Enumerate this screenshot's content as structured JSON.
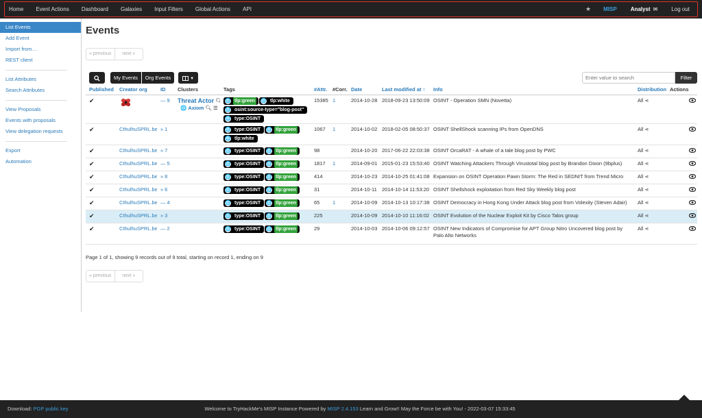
{
  "nav": {
    "items": [
      "Home",
      "Event Actions",
      "Dashboard",
      "Galaxies",
      "Input Filters",
      "Global Actions",
      "API"
    ],
    "star_icon": "star-icon",
    "instance": "MISP",
    "user": "Analyst",
    "mail_icon": "envelope-icon",
    "logout": "Log out"
  },
  "sidebar": {
    "group1": [
      "List Events",
      "Add Event",
      "Import from…",
      "REST client"
    ],
    "group2": [
      "List Attributes",
      "Search Attributes"
    ],
    "group3": [
      "View Proposals",
      "Events with proposals",
      "View delegation requests"
    ],
    "group4": [
      "Export",
      "Automation"
    ]
  },
  "main": {
    "title": "Events",
    "pager": {
      "prev": "« previous",
      "next": "next »"
    },
    "toolbar": {
      "my_events": "My Events",
      "org_events": "Org Events",
      "search_placeholder": "Enter value to search",
      "filter": "Filter"
    },
    "columns": [
      "Published",
      "Creator org",
      "ID",
      "Clusters",
      "Tags",
      "#Attr.",
      "#Corr.",
      "Date",
      "Last modified at ↑",
      "Info",
      "Distribution",
      "Actions"
    ],
    "rows": [
      {
        "published": "✔",
        "org": "",
        "org_logo": true,
        "id_prefix": "—",
        "id": "9",
        "cluster": "Threat Actor",
        "cluster_sub": "Axiom",
        "tags": [
          "tlp:green",
          "tlp:white",
          "osint:source-type=\"blog-post\"",
          "type:OSINT"
        ],
        "attr": "15385",
        "corr": "1",
        "date": "2014-10-28",
        "modified": "2018-09-23 13:50:09",
        "info": "OSINT - Operation SMN (Novetta)",
        "dist": "All"
      },
      {
        "published": "✔",
        "org": "CthulhuSPRL.be",
        "id_prefix": "»",
        "id": "1",
        "tags": [
          "type:OSINT",
          "tlp:green",
          "tlp:white"
        ],
        "attr": "1067",
        "corr": "1",
        "date": "2014-10-02",
        "modified": "2018-02-05 08:50:37",
        "info": "OSINT ShellShock scanning IPs from OpenDNS",
        "dist": "All"
      },
      {
        "published": "✔",
        "org": "CthulhuSPRL.be",
        "id_prefix": "»",
        "id": "7",
        "tags": [
          "type:OSINT",
          "tlp:green"
        ],
        "attr": "98",
        "corr": "",
        "date": "2014-10-20",
        "modified": "2017-06-22 22:03:38",
        "info": "OSINT OrcaRAT - A whale of a tale blog post by PWC",
        "dist": "All"
      },
      {
        "published": "✔",
        "org": "CthulhuSPRL.be",
        "id_prefix": "—",
        "id": "5",
        "tags": [
          "type:OSINT",
          "tlp:green"
        ],
        "attr": "1817",
        "corr": "1",
        "date": "2014-09-01",
        "modified": "2015-01-23 15:53:40",
        "info": "OSINT Watching Attackers Through Virustotal blog post by Brandon Dixon (9bplus)",
        "dist": "All"
      },
      {
        "published": "✔",
        "org": "CthulhuSPRL.be",
        "id_prefix": "»",
        "id": "8",
        "tags": [
          "type:OSINT",
          "tlp:green"
        ],
        "attr": "414",
        "corr": "",
        "date": "2014-10-23",
        "modified": "2014-10-25 01:41:08",
        "info": "Expansion on OSINT Operation Pawn Storm: The Red in SEDNIT from Trend Micro",
        "dist": "All"
      },
      {
        "published": "✔",
        "org": "CthulhuSPRL.be",
        "id_prefix": "»",
        "id": "6",
        "tags": [
          "type:OSINT",
          "tlp:green"
        ],
        "attr": "31",
        "corr": "",
        "date": "2014-10-11",
        "modified": "2014-10-14 11:53:20",
        "info": "OSINT Shellshock exploitation from Red Sky Weekly blog post",
        "dist": "All"
      },
      {
        "published": "✔",
        "org": "CthulhuSPRL.be",
        "id_prefix": "—",
        "id": "4",
        "tags": [
          "type:OSINT",
          "tlp:green"
        ],
        "attr": "65",
        "corr": "1",
        "date": "2014-10-09",
        "modified": "2014-10-13 10:17:38",
        "info": "OSINT Democracy in Hong Kong Under Attack blog post from Volexity (Steven Adair)",
        "dist": "All"
      },
      {
        "published": "✔",
        "org": "CthulhuSPRL.be",
        "id_prefix": "»",
        "id": "3",
        "tags": [
          "type:OSINT",
          "tlp:green"
        ],
        "attr": "225",
        "corr": "",
        "date": "2014-10-09",
        "modified": "2014-10-10 11:16:02",
        "info": "OSINT Evolution of the Nuclear Exploit Kit by Cisco Talos group",
        "dist": "All",
        "highlight": true
      },
      {
        "published": "✔",
        "org": "CthulhuSPRL.be",
        "id_prefix": "—",
        "id": "2",
        "tags": [
          "type:OSINT",
          "tlp:green"
        ],
        "attr": "29",
        "corr": "",
        "date": "2014-10-03",
        "modified": "2014-10-06 09:12:57",
        "info": "OSINT New Indicators of Compromise for APT Group Nitro Uncovered blog post by Palo Alto Networks",
        "dist": "All"
      }
    ],
    "summary": "Page 1 of 1, showing 9 records out of 9 total, starting on record 1, ending on 9"
  },
  "footer": {
    "download_label": "Download:",
    "pgp_link": "PGP public key",
    "welcome_pre": "Welcome to TryHackMe's MISP Instance Powered by",
    "misp_version": "MISP 2.4.153",
    "welcome_post": "Learn and Grow!! May the Force be with You! - 2022-03-07 15:33:45"
  },
  "colors": {
    "nav_bg": "#222222",
    "frame": "#e0342a",
    "link": "#2a7ab8",
    "active": "#3a87c8",
    "tag_green": "#33a23b",
    "row_highlight": "#d9edf7"
  }
}
